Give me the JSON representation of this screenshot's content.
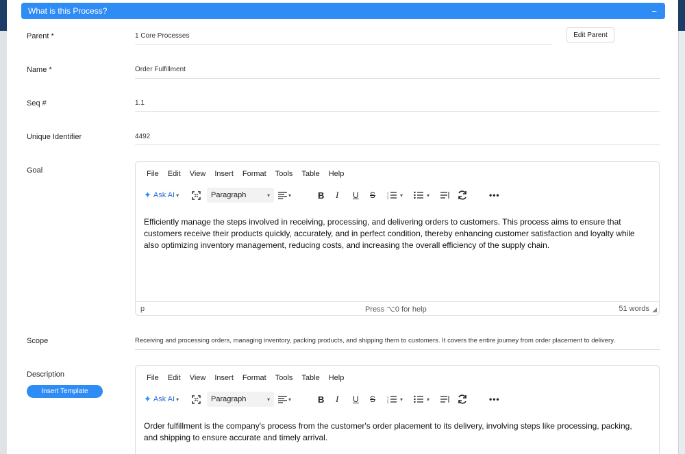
{
  "section": {
    "title": "What is this Process?",
    "collapse_symbol": "−"
  },
  "fields": {
    "parent": {
      "label": "Parent  *",
      "value": "1 Core Processes",
      "edit_label": "Edit Parent"
    },
    "name": {
      "label": "Name *",
      "value": "Order Fulfillment"
    },
    "seq": {
      "label": "Seq #",
      "value": "1.1"
    },
    "uid": {
      "label": "Unique Identifier",
      "value": "4492"
    },
    "goal": {
      "label": "Goal"
    },
    "scope": {
      "label": "Scope",
      "value": "Receiving and processing orders, managing inventory, packing products, and shipping them to customers. It covers the entire journey from order placement to delivery."
    },
    "description": {
      "label": "Description",
      "insert_template_label": "Insert Template"
    }
  },
  "editor": {
    "menu": [
      "File",
      "Edit",
      "View",
      "Insert",
      "Format",
      "Tools",
      "Table",
      "Help"
    ],
    "ask_ai_label": "Ask AI",
    "block_format": "Paragraph",
    "status_path": "p",
    "status_help": "Press ⌥0 for help"
  },
  "goal_editor": {
    "content": "Efficiently manage the steps involved in receiving, processing, and delivering orders to customers. This process aims to ensure that customers receive their products quickly, accurately, and in perfect condition, thereby enhancing customer satisfaction and loyalty while also optimizing inventory management, reducing costs, and increasing the overall efficiency of the supply chain.",
    "word_count": "51 words"
  },
  "description_editor": {
    "content": "Order fulfillment is the company's process from the customer's order placement to its delivery, involving steps like processing, packing, and shipping to ensure accurate and timely arrival."
  },
  "colors": {
    "accent": "#2f8cf5",
    "backdrop": "#1c3d66"
  }
}
